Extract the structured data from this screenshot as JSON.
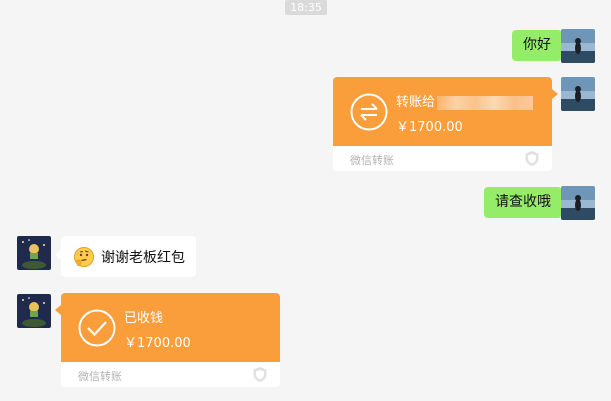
{
  "timestamp": "18:35",
  "colors": {
    "green_bubble": "#95ec69",
    "transfer_orange": "#fa9d3b",
    "background": "#f5f5f5"
  },
  "messages": [
    {
      "side": "right",
      "type": "text",
      "text": "你好"
    },
    {
      "side": "right",
      "type": "transfer",
      "title": "转账给",
      "amount": "￥1700.00",
      "footer": "微信转账",
      "icon": "transfer-arrows-icon"
    },
    {
      "side": "right",
      "type": "text",
      "text": "请查收哦"
    },
    {
      "side": "left",
      "type": "text",
      "emoji": "thinking-face-emoji",
      "text": "谢谢老板红包"
    },
    {
      "side": "left",
      "type": "transfer",
      "title": "已收钱",
      "amount": "￥1700.00",
      "footer": "微信转账",
      "icon": "checkmark-icon"
    }
  ]
}
